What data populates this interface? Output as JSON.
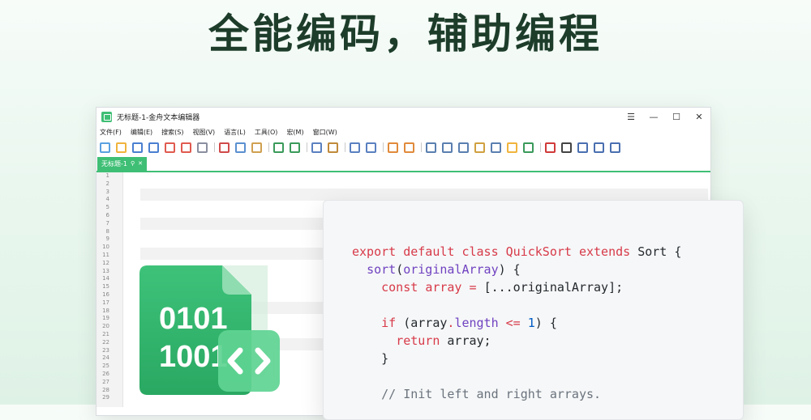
{
  "headline": "全能编码，辅助编程",
  "window": {
    "title": "无标题-1-金舟文本编辑器",
    "controls": {
      "menu": "☰",
      "minimize": "—",
      "maximize": "☐",
      "close": "✕"
    },
    "menu": [
      "文件(F)",
      "编辑(E)",
      "搜索(S)",
      "视图(V)",
      "语言(L)",
      "工具(O)",
      "宏(M)",
      "窗口(W)"
    ],
    "tab": {
      "label": "无标题-1",
      "pin": "⚲",
      "close": "✕"
    },
    "line_numbers": [
      "1",
      "2",
      "3",
      "4",
      "5",
      "6",
      "7",
      "8",
      "9",
      "10",
      "11",
      "12",
      "13",
      "14",
      "15",
      "16",
      "17",
      "18",
      "19",
      "20",
      "21",
      "22",
      "23",
      "24",
      "25",
      "26",
      "27",
      "28",
      "29"
    ],
    "colors": {
      "accent": "#3fbf75"
    }
  },
  "toolbar_icons": [
    "new-file-icon",
    "open-folder-icon",
    "save-icon",
    "save-all-icon",
    "close-file-icon",
    "close-all-icon",
    "print-icon",
    "sep",
    "cut-icon",
    "copy-icon",
    "paste-icon",
    "sep",
    "undo-icon",
    "redo-icon",
    "sep",
    "find-icon",
    "replace-icon",
    "sep",
    "zoom-in-icon",
    "zoom-out-icon",
    "sep",
    "sync-v-icon",
    "sync-h-icon",
    "sep",
    "wrap-icon",
    "show-symbols-icon",
    "indent-guide-icon",
    "doc-map-icon",
    "function-list-icon",
    "folder-workspace-icon",
    "monitor-icon",
    "sep",
    "record-macro-icon",
    "stop-macro-icon",
    "play-macro-icon",
    "run-macro-multiple-icon",
    "save-macro-icon"
  ],
  "code": {
    "lines": [
      [
        [
          "kw",
          "export "
        ],
        [
          "kw",
          "default "
        ],
        [
          "kw",
          "class "
        ],
        [
          "cls",
          "QuickSort "
        ],
        [
          "kw",
          "extends "
        ],
        [
          "",
          "Sort {"
        ]
      ],
      [
        [
          "",
          "  "
        ],
        [
          "fn",
          "sort"
        ],
        [
          "",
          "("
        ],
        [
          "fn",
          "originalArray"
        ],
        [
          "",
          ") {"
        ]
      ],
      [
        [
          "",
          "    "
        ],
        [
          "kw",
          "const "
        ],
        [
          "kw",
          "array "
        ],
        [
          "kw",
          "= "
        ],
        [
          "",
          "[...originalArray];"
        ]
      ],
      [
        [
          "",
          ""
        ]
      ],
      [
        [
          "",
          "    "
        ],
        [
          "kw",
          "if "
        ],
        [
          "",
          "(array"
        ],
        [
          "kw",
          "."
        ],
        [
          "fn",
          "length "
        ],
        [
          "kw",
          "<= "
        ],
        [
          "num",
          "1"
        ],
        [
          "",
          ") {"
        ]
      ],
      [
        [
          "",
          "      "
        ],
        [
          "kw",
          "return "
        ],
        [
          "",
          "array;"
        ]
      ],
      [
        [
          "",
          "    }"
        ]
      ],
      [
        [
          "",
          ""
        ]
      ],
      [
        [
          "",
          "    "
        ],
        [
          "cm",
          "// Init left and right arrays."
        ]
      ]
    ]
  },
  "illustration": {
    "binary_top": "0101",
    "binary_bottom": "1001",
    "code_symbol": "<>"
  }
}
